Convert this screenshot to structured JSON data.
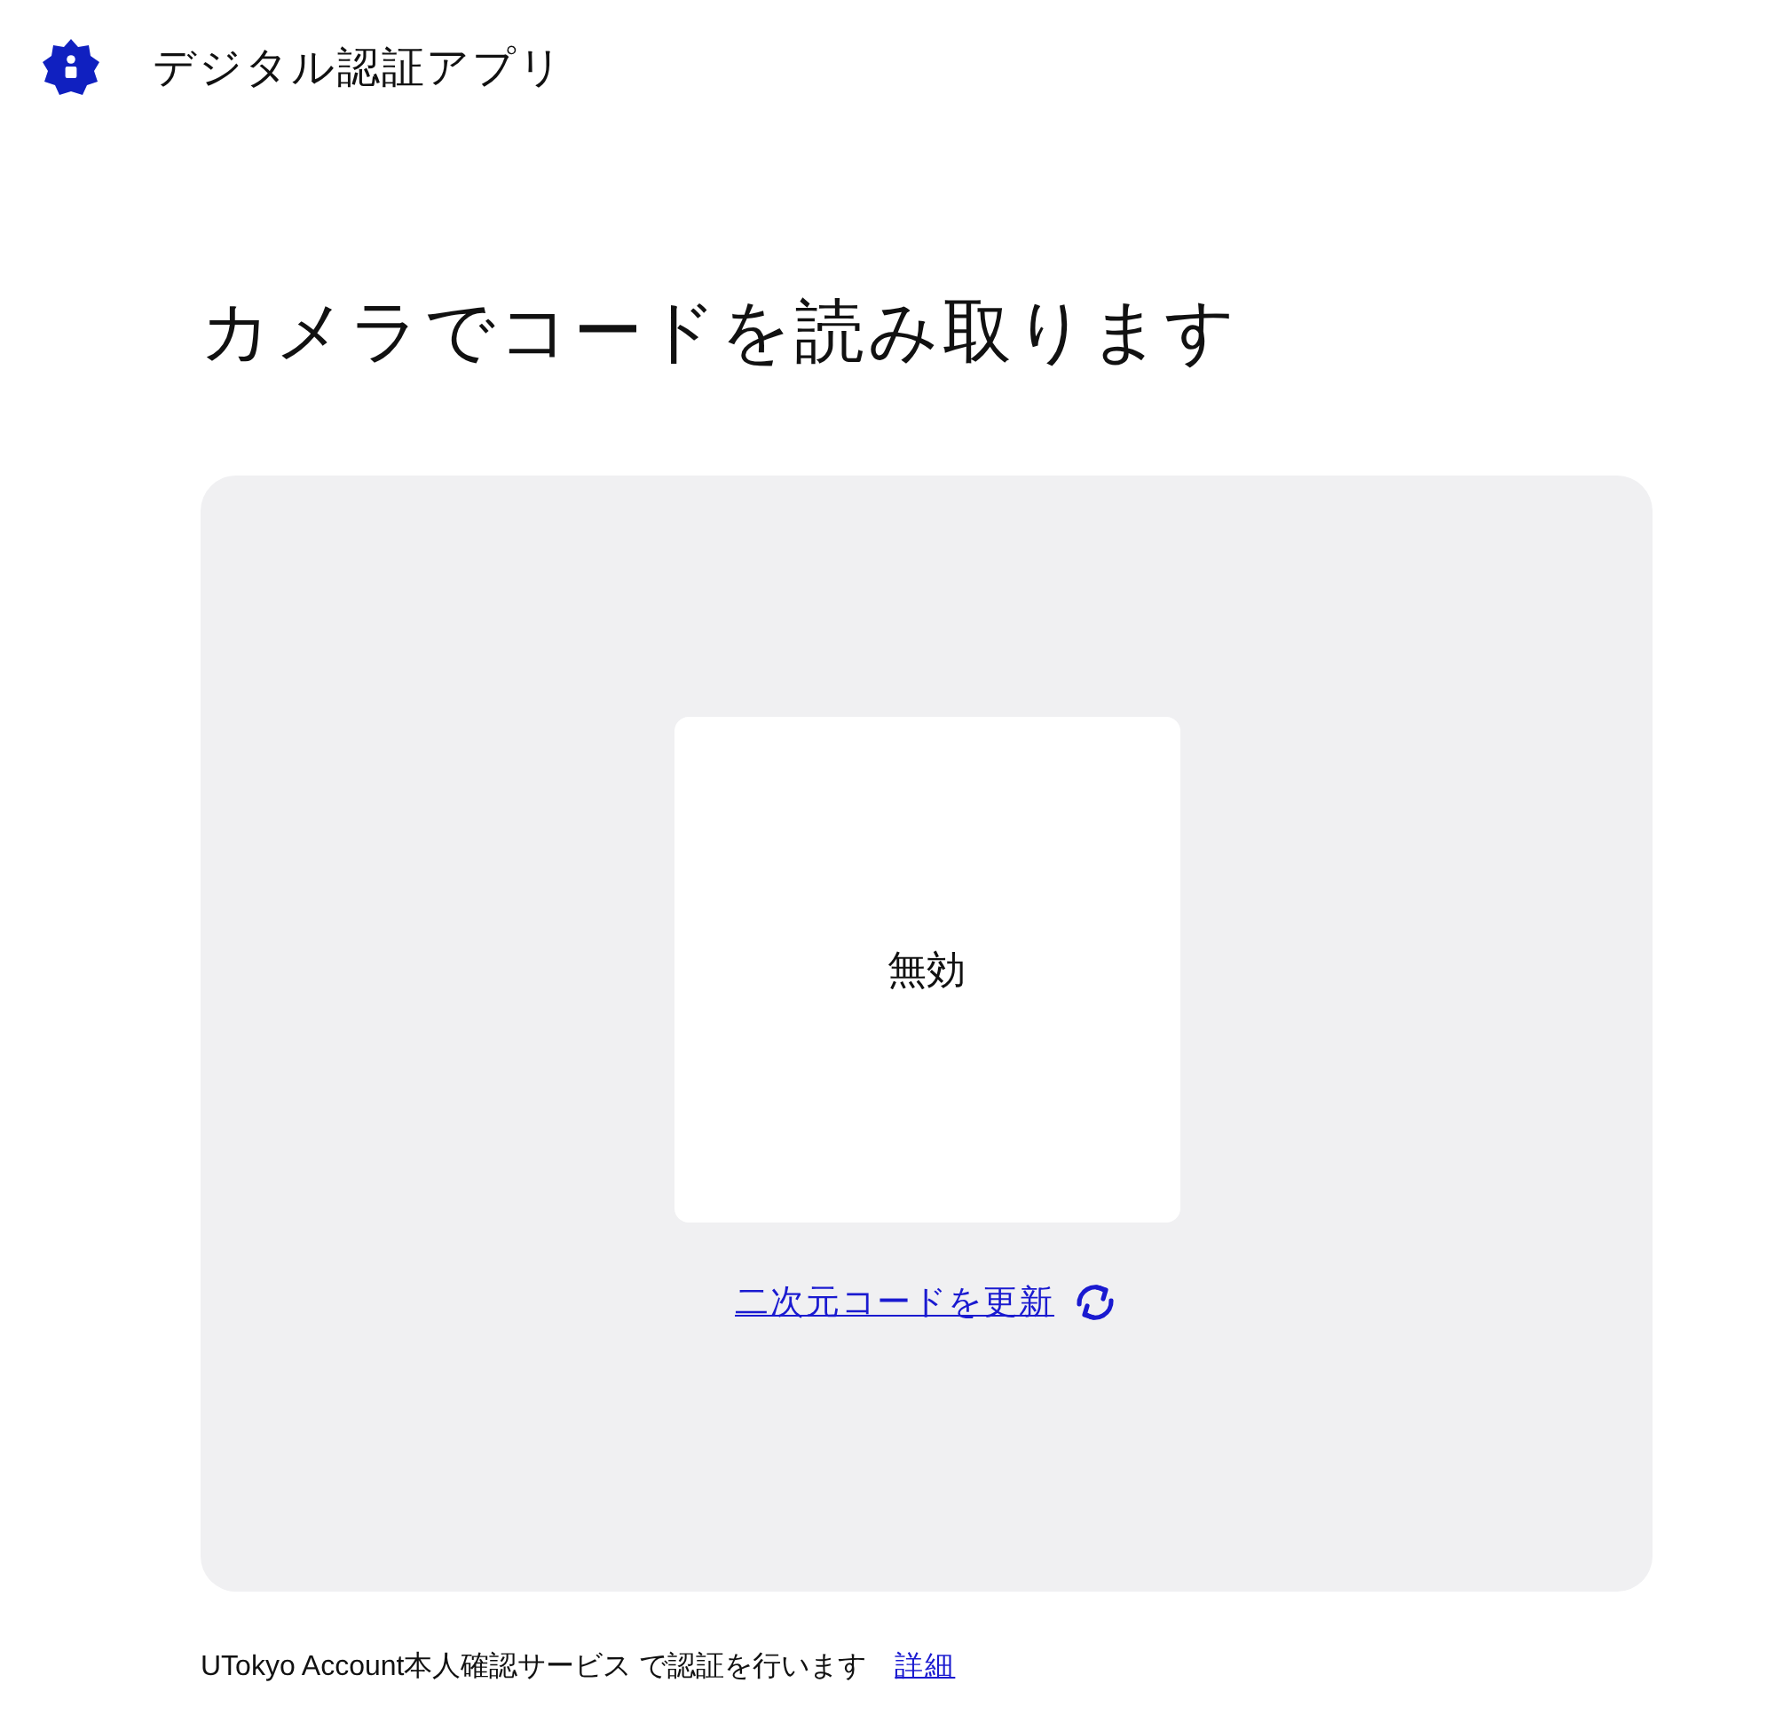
{
  "header": {
    "app_title": "デジタル認証アプリ"
  },
  "heading": "カメラでコードを読み取ります",
  "code_panel": {
    "code_status": "無効",
    "refresh_link": "二次元コードを更新"
  },
  "footer": {
    "text": "UTokyo Account本人確認サービス で認証を行います",
    "link": "詳細"
  }
}
